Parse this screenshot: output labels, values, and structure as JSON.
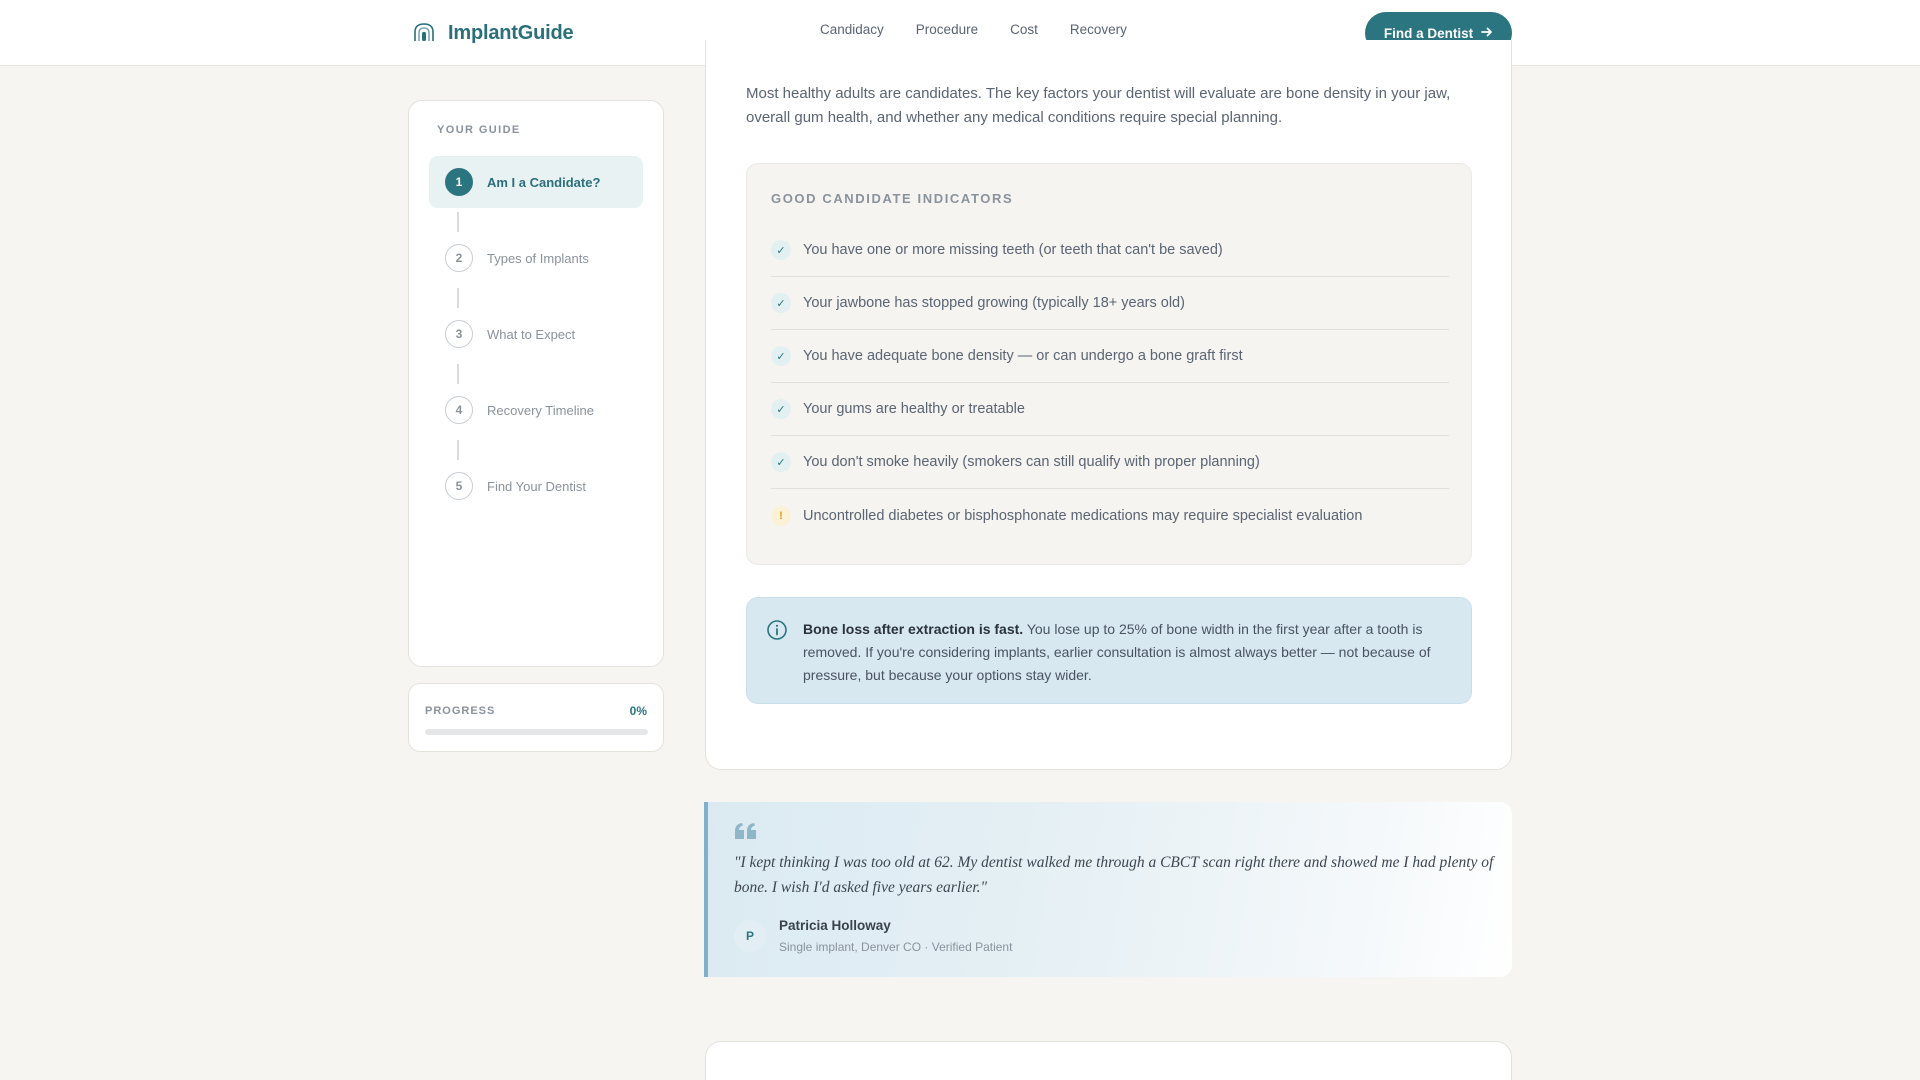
{
  "header": {
    "brand": "ImplantGuide",
    "nav": [
      "Candidacy",
      "Procedure",
      "Cost",
      "Recovery"
    ],
    "cta_label": "Find a Dentist"
  },
  "sidebar": {
    "title": "YOUR GUIDE",
    "steps": [
      {
        "num": "1",
        "label": "Am I a Candidate?",
        "active": true
      },
      {
        "num": "2",
        "label": "Types of Implants",
        "active": false
      },
      {
        "num": "3",
        "label": "What to Expect",
        "active": false
      },
      {
        "num": "4",
        "label": "Recovery Timeline",
        "active": false
      },
      {
        "num": "5",
        "label": "Find Your Dentist",
        "active": false
      }
    ],
    "progress": {
      "label": "PROGRESS",
      "value_text": "0%",
      "value": 0
    }
  },
  "main": {
    "intro": "Most healthy adults are candidates. The key factors your dentist will evaluate are bone density in your jaw, overall gum health, and whether any medical conditions require special planning.",
    "indicators": {
      "title": "GOOD CANDIDATE INDICATORS",
      "items": [
        {
          "mark": "✓",
          "type": "check",
          "text": "You have one or more missing teeth (or teeth that can't be saved)"
        },
        {
          "mark": "✓",
          "type": "check",
          "text": "Your jawbone has stopped growing (typically 18+ years old)"
        },
        {
          "mark": "✓",
          "type": "check",
          "text": "You have adequate bone density — or can undergo a bone graft first"
        },
        {
          "mark": "✓",
          "type": "check",
          "text": "Your gums are healthy or treatable"
        },
        {
          "mark": "✓",
          "type": "check",
          "text": "You don't smoke heavily (smokers can still qualify with proper planning)"
        },
        {
          "mark": "!",
          "type": "warning",
          "text": "Uncontrolled diabetes or bisphosphonate medications may require specialist evaluation"
        }
      ]
    },
    "callout": {
      "bold": "Bone loss after extraction is fast.",
      "text": " You lose up to 25% of bone width in the first year after a tooth is removed. If you're considering implants, earlier consultation is almost always better — not because of pressure, but because your options stay wider."
    }
  },
  "testimonial": {
    "quote": "\"I kept thinking I was too old at 62. My dentist walked me through a CBCT scan right there and showed me I had plenty of bone. I wish I'd asked five years earlier.\"",
    "avatar_initial": "P",
    "author": "Patricia Holloway",
    "meta": "Single implant, Denver CO · Verified Patient"
  },
  "colors": {
    "accent": "#2b7580",
    "warning": "#d8a21a",
    "callout_bg": "#d7e8f1"
  }
}
